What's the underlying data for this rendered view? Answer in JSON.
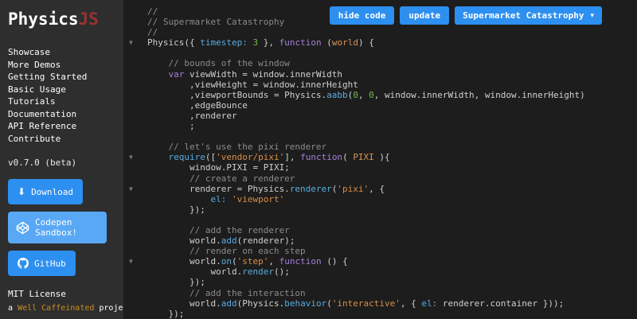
{
  "colors": {
    "accent_blue": "#2d8ff0",
    "codepen_blue": "#58a8f5",
    "logo_red": "#993333",
    "brand_orange": "#cf8f1d",
    "sidebar_bg": "#2e2e2e",
    "editor_bg": "#1d1d1d",
    "syntax": {
      "default": "#cfcfcf",
      "comment": "#8b8b8b",
      "keyword": "#a57fdc",
      "string": "#d98e48",
      "number": "#69bf45",
      "property": "#58abdf",
      "param": "#d79456"
    }
  },
  "icons": {
    "download": "⬇",
    "chevron_down": "▾",
    "fold_arrow": "▼"
  },
  "sidebar": {
    "logo": {
      "part1": "Physics",
      "part2": "JS"
    },
    "nav": [
      "Showcase",
      "More Demos",
      "Getting Started",
      "Basic Usage",
      "Tutorials",
      "Documentation",
      "API Reference",
      "Contribute"
    ],
    "version": "v0.7.0 (beta)",
    "buttons": {
      "download": "Download",
      "codepen": "Codepen Sandbox!",
      "github": "GitHub"
    },
    "license": "MIT License",
    "footer": {
      "pre": "a ",
      "brand": "Well Caffeinated",
      "post": " project"
    }
  },
  "toolbar": {
    "hide_code": "hide code",
    "update": "update",
    "demo_select": "Supermarket Catastrophy"
  },
  "editor": {
    "lines": [
      {
        "t": [
          [
            "c",
            "//"
          ]
        ]
      },
      {
        "t": [
          [
            "c",
            "// Supermarket Catastrophy"
          ]
        ]
      },
      {
        "t": [
          [
            "c",
            "//"
          ]
        ]
      },
      {
        "fold": true,
        "t": [
          [
            "d",
            "Physics({ "
          ],
          [
            "p",
            "timestep:"
          ],
          [
            "d",
            " "
          ],
          [
            "n",
            "3"
          ],
          [
            "d",
            " }, "
          ],
          [
            "k",
            "function"
          ],
          [
            "d",
            " ("
          ],
          [
            "o",
            "world"
          ],
          [
            "d",
            ") {"
          ]
        ]
      },
      {
        "t": []
      },
      {
        "t": [
          [
            "c",
            "    // bounds of the window"
          ]
        ]
      },
      {
        "t": [
          [
            "d",
            "    "
          ],
          [
            "k",
            "var"
          ],
          [
            "d",
            " viewWidth = window.innerWidth"
          ]
        ]
      },
      {
        "t": [
          [
            "d",
            "        ,viewHeight = window.innerHeight"
          ]
        ]
      },
      {
        "t": [
          [
            "d",
            "        ,viewportBounds = Physics."
          ],
          [
            "f",
            "aabb"
          ],
          [
            "d",
            "("
          ],
          [
            "n",
            "0"
          ],
          [
            "d",
            ", "
          ],
          [
            "n",
            "0"
          ],
          [
            "d",
            ", window.innerWidth, window.innerHeight)"
          ]
        ]
      },
      {
        "t": [
          [
            "d",
            "        ,edgeBounce"
          ]
        ]
      },
      {
        "t": [
          [
            "d",
            "        ,renderer"
          ]
        ]
      },
      {
        "t": [
          [
            "d",
            "        ;"
          ]
        ]
      },
      {
        "t": []
      },
      {
        "t": [
          [
            "c",
            "    // let's use the pixi renderer"
          ]
        ]
      },
      {
        "fold": true,
        "t": [
          [
            "d",
            "    "
          ],
          [
            "f",
            "require"
          ],
          [
            "d",
            "(["
          ],
          [
            "s",
            "'vendor/pixi'"
          ],
          [
            "d",
            "], "
          ],
          [
            "k",
            "function"
          ],
          [
            "d",
            "( "
          ],
          [
            "o",
            "PIXI"
          ],
          [
            "d",
            " ){"
          ]
        ]
      },
      {
        "t": [
          [
            "d",
            "        window.PIXI = PIXI;"
          ]
        ]
      },
      {
        "t": [
          [
            "c",
            "        // create a renderer"
          ]
        ]
      },
      {
        "fold": true,
        "t": [
          [
            "d",
            "        renderer = Physics."
          ],
          [
            "f",
            "renderer"
          ],
          [
            "d",
            "("
          ],
          [
            "s",
            "'pixi'"
          ],
          [
            "d",
            ", {"
          ]
        ]
      },
      {
        "t": [
          [
            "d",
            "            "
          ],
          [
            "p",
            "el:"
          ],
          [
            "d",
            " "
          ],
          [
            "s",
            "'viewport'"
          ]
        ]
      },
      {
        "t": [
          [
            "d",
            "        });"
          ]
        ]
      },
      {
        "t": []
      },
      {
        "t": [
          [
            "c",
            "        // add the renderer"
          ]
        ]
      },
      {
        "t": [
          [
            "d",
            "        world."
          ],
          [
            "f",
            "add"
          ],
          [
            "d",
            "(renderer);"
          ]
        ]
      },
      {
        "t": [
          [
            "c",
            "        // render on each step"
          ]
        ]
      },
      {
        "fold": true,
        "t": [
          [
            "d",
            "        world."
          ],
          [
            "f",
            "on"
          ],
          [
            "d",
            "("
          ],
          [
            "s",
            "'step'"
          ],
          [
            "d",
            ", "
          ],
          [
            "k",
            "function"
          ],
          [
            "d",
            " () {"
          ]
        ]
      },
      {
        "t": [
          [
            "d",
            "            world."
          ],
          [
            "f",
            "render"
          ],
          [
            "d",
            "();"
          ]
        ]
      },
      {
        "t": [
          [
            "d",
            "        });"
          ]
        ]
      },
      {
        "t": [
          [
            "c",
            "        // add the interaction"
          ]
        ]
      },
      {
        "t": [
          [
            "d",
            "        world."
          ],
          [
            "f",
            "add"
          ],
          [
            "d",
            "(Physics."
          ],
          [
            "f",
            "behavior"
          ],
          [
            "d",
            "("
          ],
          [
            "s",
            "'interactive'"
          ],
          [
            "d",
            ", { "
          ],
          [
            "p",
            "el:"
          ],
          [
            "d",
            " renderer.container }));"
          ]
        ]
      },
      {
        "t": [
          [
            "d",
            "    });"
          ]
        ]
      }
    ]
  }
}
